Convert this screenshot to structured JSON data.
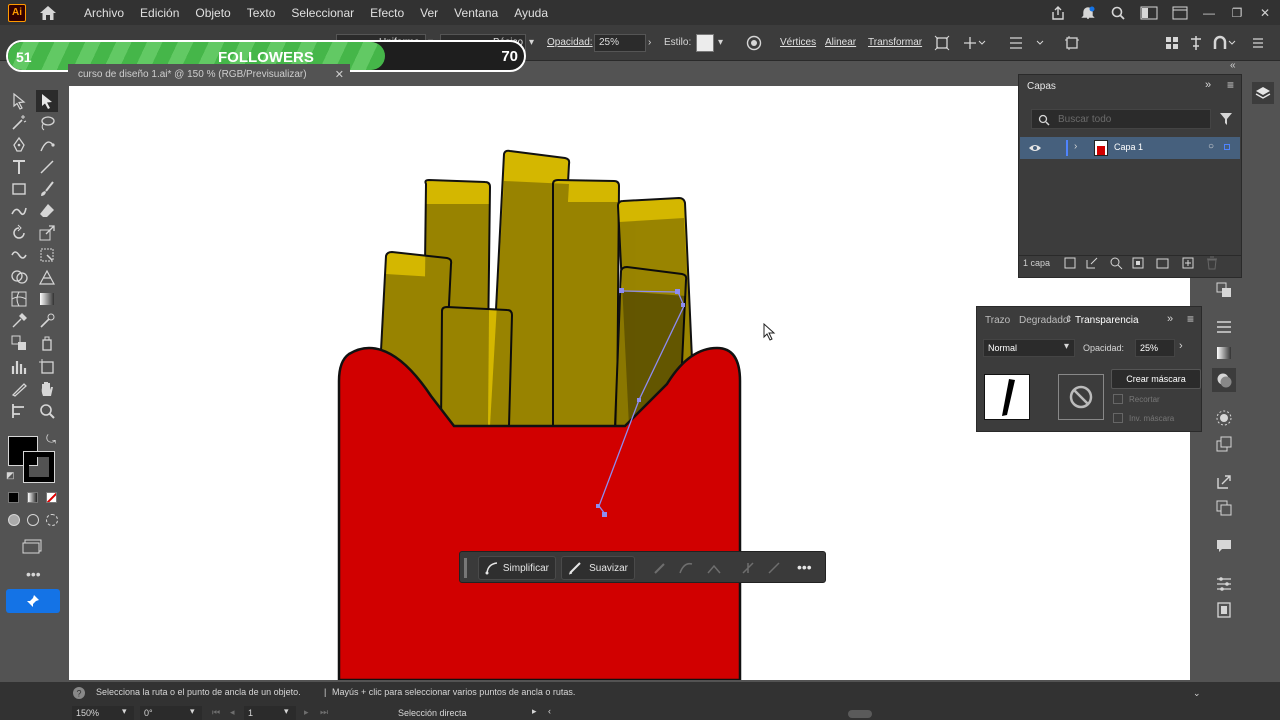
{
  "menubar": {
    "app_logo": "Ai",
    "items": [
      "Archivo",
      "Edición",
      "Objeto",
      "Texto",
      "Seleccionar",
      "Efecto",
      "Ver",
      "Ventana",
      "Ayuda"
    ]
  },
  "controlbar": {
    "stroke_profile": "Uniforme",
    "brush": "Básico",
    "opacity_label": "Opacidad:",
    "opacity_value": "25%",
    "style_label": "Estilo:",
    "vertices": "Vértices",
    "align": "Alinear",
    "transform": "Transformar"
  },
  "followers": {
    "current": "51",
    "label": "FOLLOWERS",
    "goal": "70",
    "progress": 0.73
  },
  "document": {
    "tab_title": "curso de diseño 1.ai* @ 150 % (RGB/Previsualizar)"
  },
  "layers_panel": {
    "title": "Capas",
    "search_placeholder": "Buscar todo",
    "layer_name": "Capa 1",
    "layer_count": "1 capa"
  },
  "transparency_panel": {
    "tabs": [
      "Trazo",
      "Degradado",
      "Transparencia"
    ],
    "blend_mode": "Normal",
    "opacity_label": "Opacidad:",
    "opacity_value": "25%",
    "create_mask": "Crear máscara",
    "clip": "Recortar",
    "invert_mask": "Inv. máscara"
  },
  "context_bar": {
    "simplify": "Simplificar",
    "smooth": "Suavizar"
  },
  "status": {
    "hint": "Selecciona la ruta o el punto de ancla de un objeto.",
    "hint2": "Mayús + clic para seleccionar varios puntos de ancla o rutas.",
    "zoom": "150%",
    "rotation": "0°",
    "artboard": "1",
    "tool_name": "Selección directa"
  },
  "colors": {
    "fill": "#d10000",
    "fries": "#d4b700",
    "accent": "#1473e6",
    "progress": "#45b649"
  }
}
